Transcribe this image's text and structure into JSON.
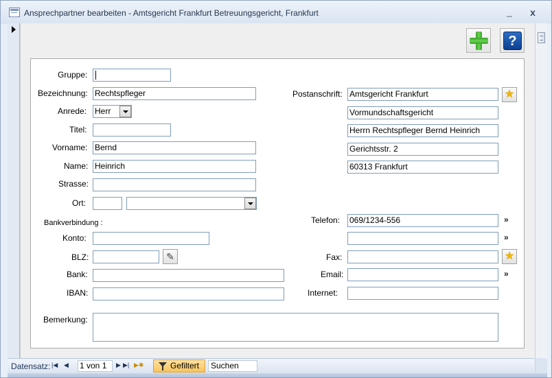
{
  "window": {
    "title": "Ansprechpartner bearbeiten - Amtsgericht Frankfurt Betreuungsgericht, Frankfurt",
    "minimize": "_",
    "close": "x"
  },
  "toolbar": {
    "add_icon": "plus-icon",
    "help_icon": "help-icon",
    "help_glyph": "?"
  },
  "form": {
    "gruppe": {
      "label": "Gruppe:",
      "value": ""
    },
    "bezeichnung": {
      "label": "Bezeichnung:",
      "value": "Rechtspfleger"
    },
    "anrede": {
      "label": "Anrede:",
      "value": "Herr"
    },
    "titel": {
      "label": "Titel:",
      "value": ""
    },
    "vorname": {
      "label": "Vorname:",
      "value": "Bernd"
    },
    "name": {
      "label": "Name:",
      "value": "Heinrich"
    },
    "strasse": {
      "label": "Strasse:",
      "value": ""
    },
    "ort": {
      "label": "Ort:",
      "plz_value": "",
      "ort_value": ""
    },
    "bankverbindung": {
      "label": "Bankverbindung :"
    },
    "konto": {
      "label": "Konto:",
      "value": ""
    },
    "blz": {
      "label": "BLZ:",
      "value": ""
    },
    "bank": {
      "label": "Bank:",
      "value": ""
    },
    "iban": {
      "label": "IBAN:",
      "value": ""
    },
    "bemerkung": {
      "label": "Bemerkung:",
      "value": ""
    },
    "postanschrift": {
      "label": "Postanschrift:",
      "lines": [
        "Amtsgericht Frankfurt",
        "Vormundschaftsgericht",
        "Herrn Rechtspfleger Bernd Heinrich",
        "Gerichtsstr. 2",
        "60313 Frankfurt"
      ]
    },
    "telefon": {
      "label": "Telefon:",
      "value": "069/1234-556",
      "value2": ""
    },
    "fax": {
      "label": "Fax:",
      "value": ""
    },
    "email": {
      "label": "Email:",
      "value": ""
    },
    "internet": {
      "label": "Internet:",
      "value": ""
    },
    "more_glyph": "»",
    "star_glyph": "★",
    "pencil_glyph": "✎"
  },
  "statusbar": {
    "label": "Datensatz:",
    "first": "|◀",
    "prev": "◀",
    "position": "1 von 1",
    "next": "▶",
    "last": "▶|",
    "new": "▶✱",
    "filter": "Gefiltert",
    "search": "Suchen"
  }
}
